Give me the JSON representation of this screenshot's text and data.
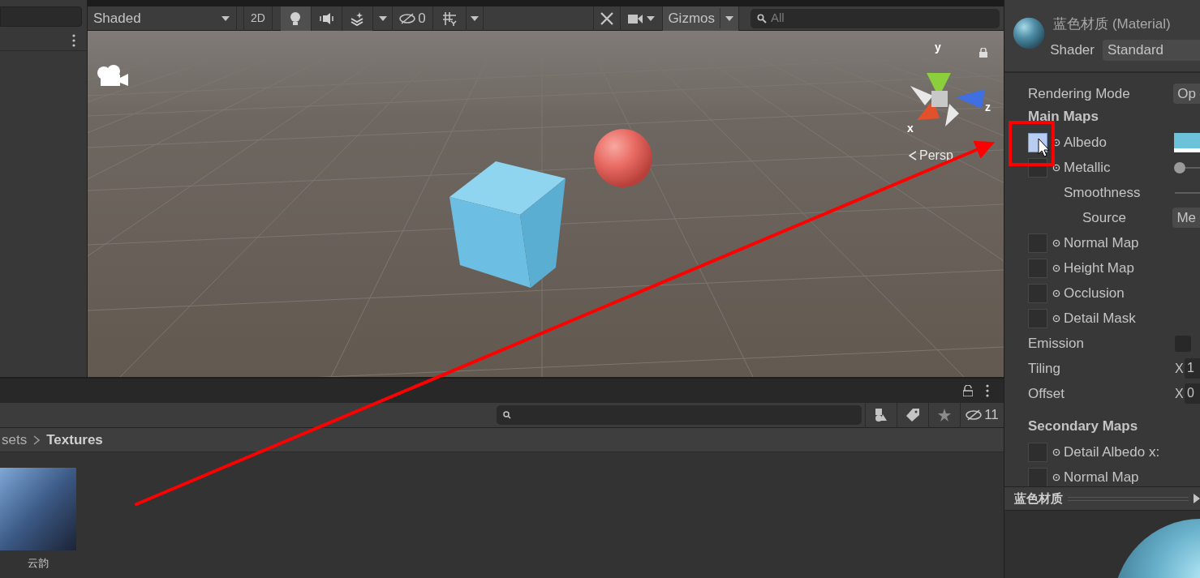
{
  "scene_toolbar": {
    "shading_mode": "Shaded",
    "mode_2d": "2D",
    "toggles": [
      {
        "kind": "lighting",
        "selected": true
      },
      {
        "kind": "audio",
        "selected": false
      },
      {
        "kind": "effects",
        "selected": false
      }
    ],
    "hidden_count": "0",
    "gizmos": "Gizmos",
    "search_placeholder": "All"
  },
  "scene": {
    "axes": [
      {
        "kind": "y",
        "label": "y"
      },
      {
        "kind": "z",
        "label": "z"
      },
      {
        "kind": "x",
        "label": "x"
      }
    ],
    "view_label": "Persp"
  },
  "project": {
    "hidden_count": "11",
    "breadcrumb": [
      "sets",
      "Textures"
    ],
    "assets": [
      {
        "name": "云韵"
      }
    ]
  },
  "inspector": {
    "title": "蓝色材质 (Material)",
    "shader_label": "Shader",
    "shader": "Standard",
    "properties": [
      {
        "kind": "dropdown",
        "label": "Rendering Mode",
        "value": "Op"
      },
      {
        "kind": "header",
        "label": "Main Maps"
      },
      {
        "kind": "texture",
        "label": "Albedo",
        "highlighted": true
      },
      {
        "kind": "texture",
        "label": "Metallic",
        "highlighted": false,
        "level": 0
      },
      {
        "kind": "slider",
        "label": "Smoothness"
      },
      {
        "kind": "subdropdown",
        "label": "Source",
        "value": "Me"
      },
      {
        "kind": "texture",
        "label": "Normal Map",
        "highlighted": false
      },
      {
        "kind": "texture",
        "label": "Height Map",
        "highlighted": false
      },
      {
        "kind": "texture",
        "label": "Occlusion",
        "highlighted": false
      },
      {
        "kind": "texture",
        "label": "Detail Mask",
        "highlighted": false
      },
      {
        "kind": "checkbox",
        "label": "Emission",
        "checked": false
      },
      {
        "kind": "vector",
        "label": "Tiling",
        "axis": "X",
        "value": "1"
      },
      {
        "kind": "vector",
        "label": "Offset",
        "axis": "X",
        "value": "0"
      },
      {
        "kind": "header",
        "label": "Secondary Maps"
      },
      {
        "kind": "texture",
        "label": "Detail Albedo x:",
        "highlighted": false
      },
      {
        "kind": "texture",
        "label": "Normal Map",
        "highlighted": false
      }
    ],
    "preview_title": "蓝色材质"
  }
}
